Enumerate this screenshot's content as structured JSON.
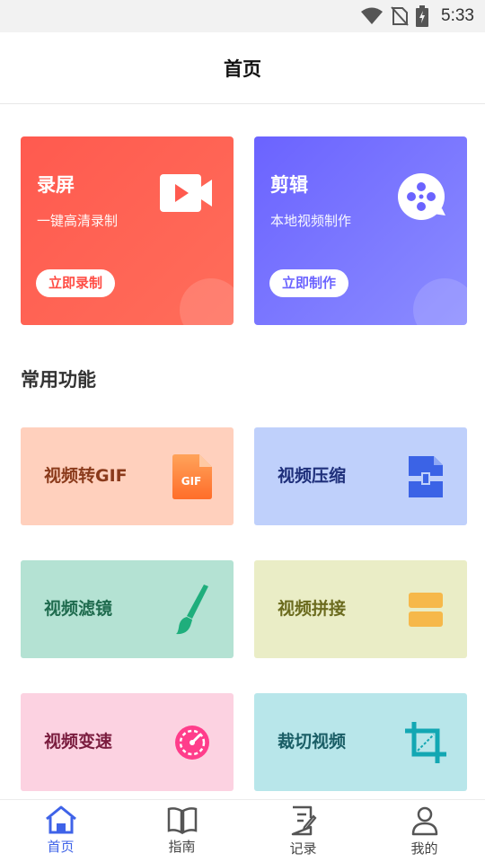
{
  "status_bar": {
    "time": "5:33"
  },
  "header": {
    "title": "首页"
  },
  "hero_cards": [
    {
      "title": "录屏",
      "subtitle": "一键高清录制",
      "button": "立即录制",
      "icon": "video-camera-icon"
    },
    {
      "title": "剪辑",
      "subtitle": "本地视频制作",
      "button": "立即制作",
      "icon": "film-reel-icon"
    }
  ],
  "section": {
    "title": "常用功能"
  },
  "functions": [
    {
      "label": "视频转GIF",
      "icon": "gif-file-icon",
      "bg": "#ffd0bd",
      "color": "#8a3a1b"
    },
    {
      "label": "视频压缩",
      "icon": "compress-file-icon",
      "bg": "#bfd0fb",
      "color": "#1e2f7a"
    },
    {
      "label": "视频滤镜",
      "icon": "paintbrush-icon",
      "bg": "#b4e2d3",
      "color": "#1f6b4e"
    },
    {
      "label": "视频拼接",
      "icon": "stack-blocks-icon",
      "bg": "#eaedc6",
      "color": "#6b6b1e"
    },
    {
      "label": "视频变速",
      "icon": "speedometer-icon",
      "bg": "#fcd2e1",
      "color": "#7a1c3e"
    },
    {
      "label": "裁切视频",
      "icon": "crop-icon",
      "bg": "#b8e6ea",
      "color": "#1a5e66"
    }
  ],
  "nav": [
    {
      "label": "首页",
      "icon": "home-icon",
      "active": true
    },
    {
      "label": "指南",
      "icon": "book-icon",
      "active": false
    },
    {
      "label": "记录",
      "icon": "document-edit-icon",
      "active": false
    },
    {
      "label": "我的",
      "icon": "user-icon",
      "active": false
    }
  ],
  "colors": {
    "accent": "#3f63e8",
    "record": "#ff5a4f",
    "edit": "#6b63ff"
  }
}
